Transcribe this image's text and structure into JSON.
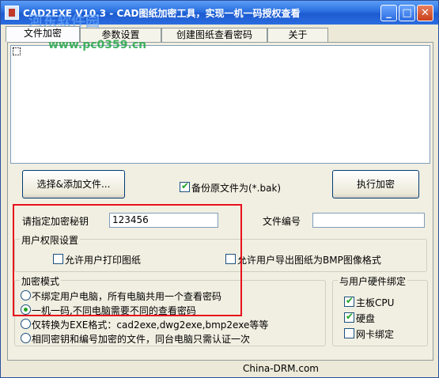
{
  "window": {
    "title": "CAD2EXE V10.3 - CAD图纸加密工具，实现一机一码授权查看",
    "watermark": "河东软件园",
    "watermark_url": "www.pc0359.cn"
  },
  "titlebar_buttons": {
    "minimize": "_",
    "maximize": "□",
    "close": "✕"
  },
  "tabs": [
    {
      "label": "文件加密"
    },
    {
      "label": "参数设置"
    },
    {
      "label": "创建图纸查看密码"
    },
    {
      "label": "关于"
    }
  ],
  "buttons": {
    "select_add_files": "选择&添加文件...",
    "execute_encrypt": "执行加密"
  },
  "backup": {
    "label": "备份原文件为(*.bak)",
    "checked": true
  },
  "key": {
    "label": "请指定加密秘钥",
    "value": "123456"
  },
  "file_number": {
    "label": "文件编号",
    "value": ""
  },
  "permissions": {
    "title": "用户权限设置",
    "allow_print": {
      "label": "允许用户打印图纸",
      "checked": false
    },
    "allow_export": {
      "label": "允许用户导出图纸为BMP图像格式",
      "checked": false
    }
  },
  "encrypt_mode": {
    "title": "加密模式",
    "options": [
      {
        "label": "不绑定用户电脑，所有电脑共用一个查看密码",
        "checked": false
      },
      {
        "label": "一机一码,不同电脑需要不同的查看密码",
        "checked": true
      },
      {
        "label": "仅转换为EXE格式：cad2exe,dwg2exe,bmp2exe等等",
        "checked": false
      },
      {
        "label": "相同密钥和编号加密的文件，同台电脑只需认证一次",
        "checked": false
      }
    ]
  },
  "hardware_binding": {
    "title": "与用户硬件绑定",
    "options": [
      {
        "label": "主板CPU",
        "checked": true
      },
      {
        "label": "硬盘",
        "checked": true
      },
      {
        "label": "网卡绑定",
        "checked": false
      }
    ]
  },
  "status": {
    "text": "China-DRM.com"
  },
  "colors": {
    "title_bar": "#2a6fe0",
    "highlight_box": "#e8101c",
    "check_green": "#21a121"
  }
}
